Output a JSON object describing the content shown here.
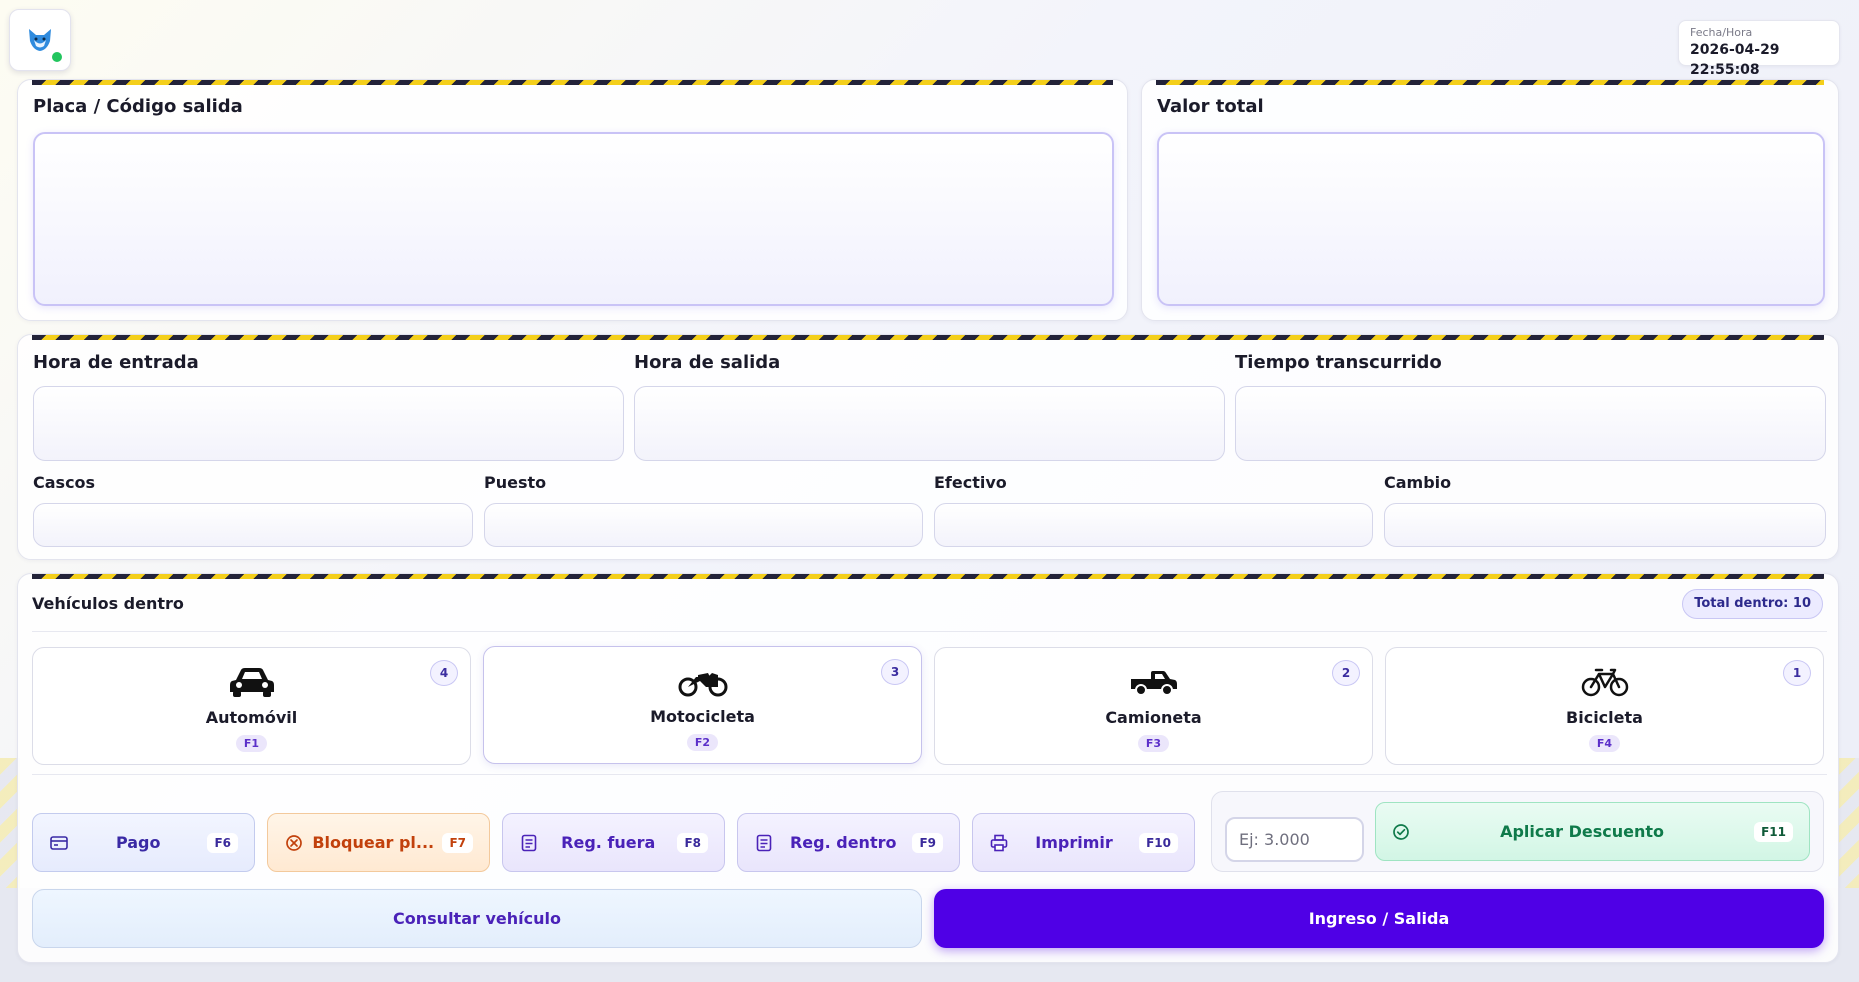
{
  "header": {
    "datetime_label": "Fecha/Hora",
    "datetime_value": "2026-04-29 22:55:08"
  },
  "exit_panel": {
    "plate_label": "Placa / Código salida",
    "total_label": "Valor total"
  },
  "details": {
    "entry_time_label": "Hora de entrada",
    "exit_time_label": "Hora de salida",
    "elapsed_label": "Tiempo transcurrido",
    "helmets_label": "Cascos",
    "spot_label": "Puesto",
    "cash_label": "Efectivo",
    "change_label": "Cambio"
  },
  "vehicles": {
    "title": "Vehículos dentro",
    "total_text": "Total dentro: 10",
    "types": [
      {
        "name": "Automóvil",
        "key": "F1",
        "count": "4",
        "icon": "car-icon"
      },
      {
        "name": "Motocicleta",
        "key": "F2",
        "count": "3",
        "icon": "motorcycle-icon"
      },
      {
        "name": "Camioneta",
        "key": "F3",
        "count": "2",
        "icon": "pickup-truck-icon"
      },
      {
        "name": "Bicicleta",
        "key": "F4",
        "count": "1",
        "icon": "bicycle-icon"
      }
    ]
  },
  "actions": [
    {
      "label": "Pago",
      "key": "F6",
      "icon": "card-icon"
    },
    {
      "label": "Bloquear pl...",
      "key": "F7",
      "icon": "block-circle-icon"
    },
    {
      "label": "Reg. fuera",
      "key": "F8",
      "icon": "document-icon"
    },
    {
      "label": "Reg. dentro",
      "key": "F9",
      "icon": "document-icon"
    },
    {
      "label": "Imprimir",
      "key": "F10",
      "icon": "printer-icon"
    }
  ],
  "discount": {
    "placeholder": "Ej: 3.000",
    "button_label": "Aplicar Descuento",
    "button_key": "F11"
  },
  "bottom": {
    "consult_label": "Consultar vehículo",
    "primary_label": "Ingreso / Salida"
  },
  "colors": {
    "primary": "#4f00e6",
    "accent_purple": "#5b2fc9",
    "hazard_yellow": "#f4cf1a",
    "hazard_dark": "#232339",
    "success_green": "#0f7a4a",
    "warning_orange": "#c2410c",
    "status_dot": "#22c55e"
  }
}
